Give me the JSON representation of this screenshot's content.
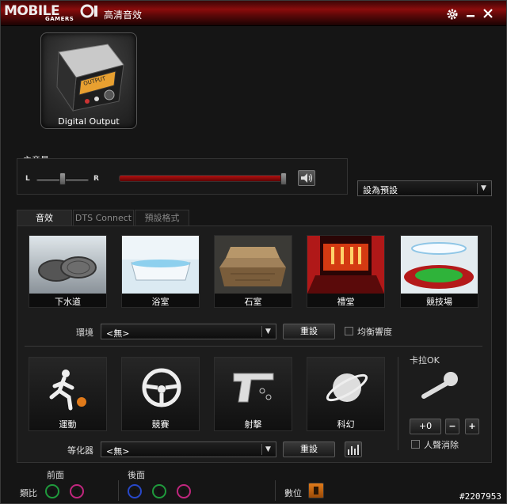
{
  "app": {
    "logo": "MOBILE",
    "logo_sub": "GAMERS",
    "title": "高清音效"
  },
  "device": {
    "label": "Digital Output",
    "screen_text": "OUTPUT"
  },
  "volume": {
    "label": "主音量",
    "left": "L",
    "right": "R",
    "balance": 0.5,
    "level": 1.0
  },
  "default_dropdown": {
    "value": "設為預設"
  },
  "tabs": [
    {
      "label": "音效",
      "active": true
    },
    {
      "label": "DTS Connect",
      "active": false
    },
    {
      "label": "預設格式",
      "active": false
    }
  ],
  "environments": [
    {
      "label": "下水道",
      "icon": "sewer-icon"
    },
    {
      "label": "浴室",
      "icon": "bathroom-icon"
    },
    {
      "label": "石室",
      "icon": "stone-room-icon"
    },
    {
      "label": "禮堂",
      "icon": "auditorium-icon"
    },
    {
      "label": "競技場",
      "icon": "arena-icon"
    }
  ],
  "environment_row": {
    "label": "環境",
    "value": "<無>",
    "reset": "重設",
    "checkbox_label": "均衡響度"
  },
  "presets": [
    {
      "label": "運動",
      "icon": "sports-icon"
    },
    {
      "label": "競賽",
      "icon": "steering-wheel-icon"
    },
    {
      "label": "射擊",
      "icon": "pistol-icon"
    },
    {
      "label": "科幻",
      "icon": "planet-icon"
    }
  ],
  "karaoke": {
    "label": "卡拉OK",
    "value": "+0",
    "minus": "−",
    "plus": "+",
    "vocal_cancel": "人聲消除"
  },
  "equalizer_row": {
    "label": "等化器",
    "value": "<無>",
    "reset": "重設"
  },
  "jacks": {
    "analog_label": "類比",
    "front_label": "前面",
    "rear_label": "後面",
    "digital_label": "數位",
    "front_colors": [
      "#1f9a3c",
      "#c0267e"
    ],
    "rear_colors": [
      "#2848c8",
      "#1f9a3c",
      "#c0267e"
    ]
  },
  "watermark": "#2207953"
}
